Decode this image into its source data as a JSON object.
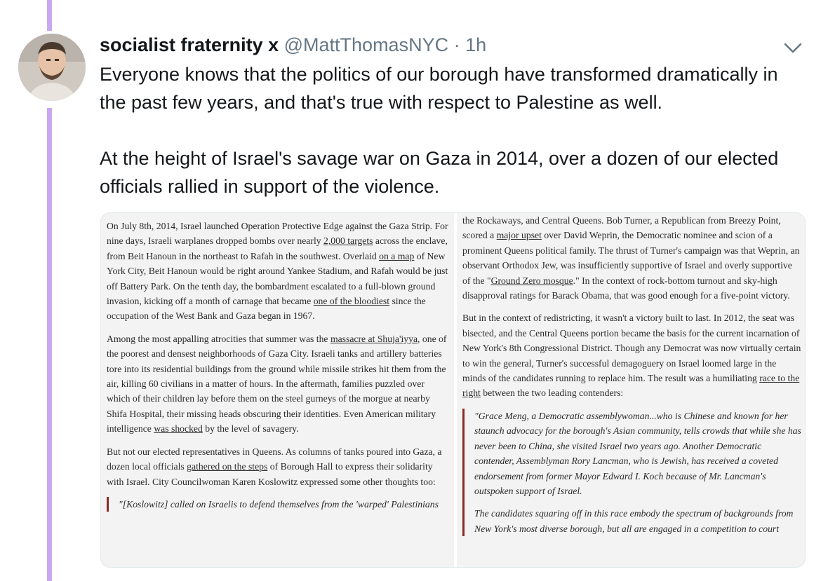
{
  "tweet": {
    "display_name": "socialist fraternity x",
    "handle": "@MattThomasNYC",
    "separator": "·",
    "time": "1h",
    "paragraphs": [
      "Everyone knows that the politics of our borough have transformed dramatically in the past few years, and that's true with respect to Palestine as well.",
      "At the height of Israel's savage war on Gaza in 2014, over a dozen of our elected officials rallied in support of the violence."
    ]
  },
  "icons": {
    "more": "chevron-down-icon",
    "avatar": "profile-photo"
  },
  "colors": {
    "thread_line": "#c8a8f0",
    "quote_bar": "#8a2b22",
    "handle_gray": "#657786"
  },
  "article": {
    "left": {
      "p1": [
        "On July 8th, 2014, Israel launched Operation Protective Edge against the Gaza Strip. For nine days, Israeli warplanes dropped bombs over nearly ",
        "2,000 targets",
        " across the enclave, from Beit Hanoun in the northeast to Rafah in the southwest. Overlaid ",
        "on a map",
        " of New York City, Beit Hanoun would be right around Yankee Stadium, and Rafah would be just off Battery Park. On the tenth day, the bombardment escalated to a full-blown ground invasion, kicking off a month of carnage that became ",
        "one of the bloodiest",
        " since the occupation of the West Bank and Gaza began in 1967."
      ],
      "p2": [
        "Among the most appalling atrocities that summer was the ",
        "massacre at Shuja'iyya",
        ", one of the poorest and densest neighborhoods of Gaza City. Israeli tanks and artillery batteries tore into its residential buildings from the ground while missile strikes hit them from the air, killing 60 civilians in a matter of hours. In the aftermath, families puzzled over which of their children lay before them on the steel gurneys of the morgue at nearby Shifa Hospital, their missing heads obscuring their identities. Even American military intelligence ",
        "was shocked",
        " by the level of savagery."
      ],
      "p3": [
        "But not our elected representatives in Queens. As columns of tanks poured into Gaza, a dozen local officials ",
        "gathered on the steps",
        " of Borough Hall to express their solidarity with Israel. City Councilwoman Karen Koslowitz expressed some other thoughts too:"
      ],
      "quote": "\"[Koslowitz] called on Israelis to defend themselves from the 'warped' Palestinians"
    },
    "right": {
      "p1": [
        "the Rockaways, and Central Queens. Bob Turner, a Republican from Breezy Point, scored a ",
        "major upset",
        " over David Weprin, the Democratic nominee and scion of a prominent Queens political family. The thrust of Turner's campaign was that Weprin, an observant Orthodox Jew, was insufficiently supportive of Israel and overly supportive of the \"",
        "Ground Zero mosque",
        ".\" In the context of rock-bottom turnout and sky-high disapproval ratings for Barack Obama, that was good enough for a five-point victory."
      ],
      "p2": [
        "But in the context of redistricting, it wasn't a victory built to last. In 2012, the seat was bisected, and the Central Queens portion became the basis for the current incarnation of New York's 8th Congressional District. Though any Democrat was now virtually certain to win the general, Turner's successful demagoguery on Israel loomed large in the minds of the candidates running to replace him. The result was a humiliating ",
        "race to the right",
        " between the two leading contenders:"
      ],
      "quote1": "\"Grace Meng, a Democratic assemblywoman...who is Chinese and known for her staunch advocacy for the borough's Asian community, tells crowds that while she has never been to China, she visited Israel two years ago. Another Democratic contender, Assemblyman Rory Lancman, who is Jewish, has received a coveted endorsement from former Mayor Edward I. Koch because of Mr. Lancman's outspoken support of Israel.",
      "quote2": "The candidates squaring off in this race embody the spectrum of backgrounds from New York's most diverse borough, but all are engaged in a competition to court"
    }
  }
}
